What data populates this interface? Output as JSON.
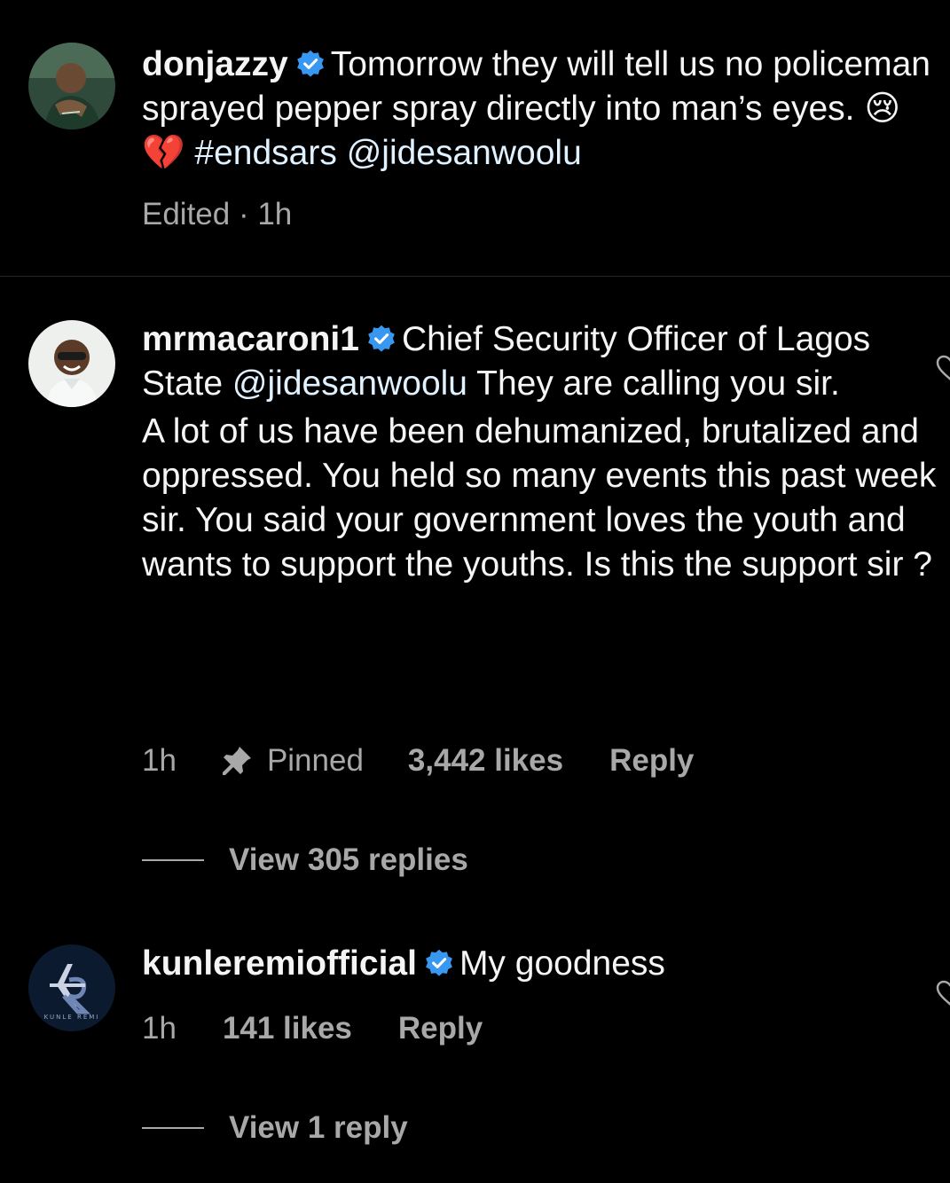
{
  "caption": {
    "username": "donjazzy",
    "text_before": "Tomorrow they will tell us no policeman sprayed pepper spray directly into man’s eyes.",
    "emoji_1": "😢",
    "emoji_2": "💔",
    "hashtag": "#endsars",
    "mention": "@jidesanwoolu",
    "status": "Edited · 1h"
  },
  "comments": [
    {
      "username": "mrmacaroni1",
      "text_1": "Chief Security Officer of Lagos State",
      "mention": "@jidesanwoolu",
      "text_2": "They are calling you sir.",
      "text_3": "A lot of us have been dehumanized, brutalized and oppressed. You held so many events this past week sir. You said your government loves the youth and wants to support the youths. Is this the support sir ?",
      "time": "1h",
      "pinned_label": "Pinned",
      "likes": "3,442 likes",
      "reply_label": "Reply",
      "view_replies": "View 305 replies"
    },
    {
      "username": "kunleremiofficial",
      "text_1": "My goodness",
      "time": "1h",
      "likes": "141 likes",
      "reply_label": "Reply",
      "view_replies": "View 1 reply",
      "avatar_logo_text": "KUNLE REMI"
    }
  ],
  "colors": {
    "background": "#000000",
    "text": "#f5f5f5",
    "secondary": "#a8a8a8",
    "link": "#e0f1ff",
    "verified": "#3897f0",
    "divider": "#262626"
  }
}
